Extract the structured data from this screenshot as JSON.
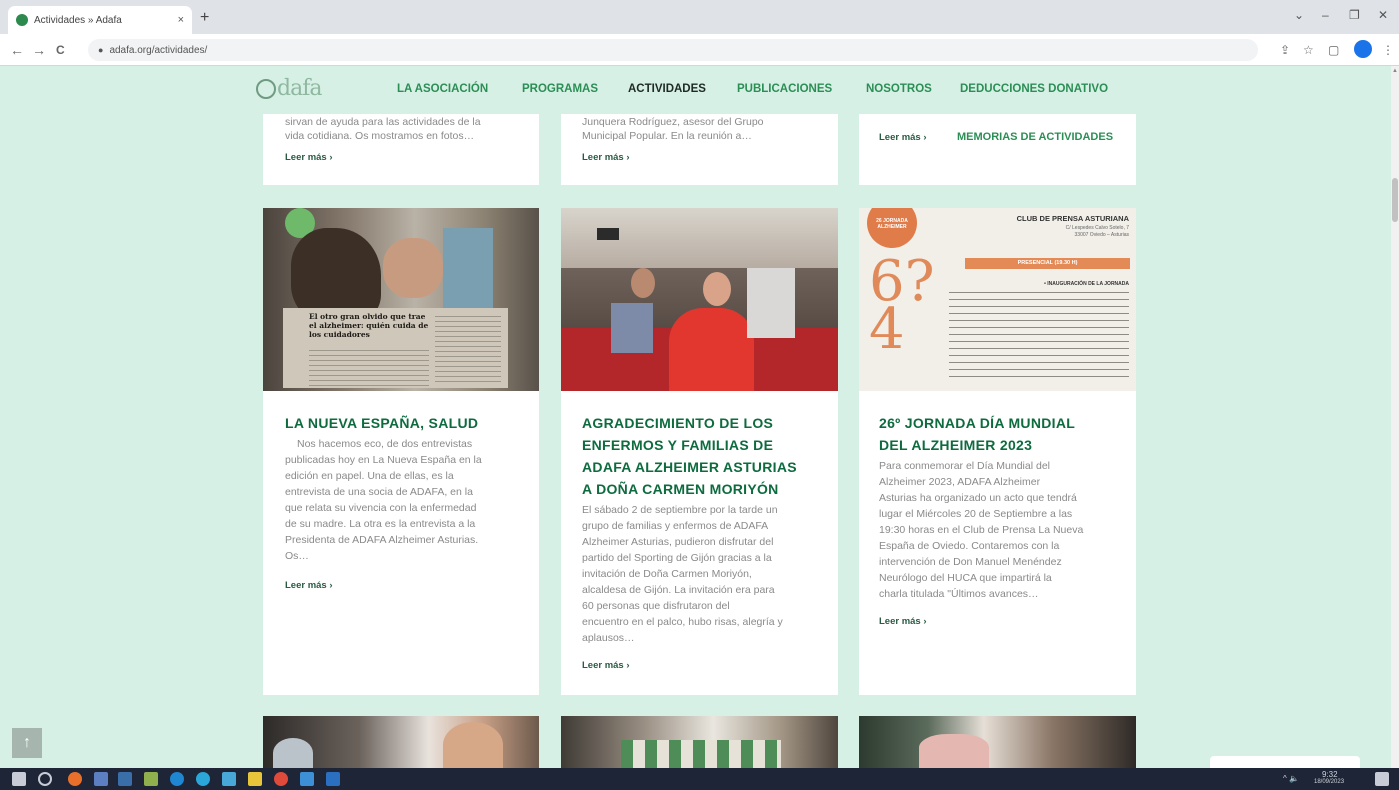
{
  "browser": {
    "tab_title": "Actividades » Adafa",
    "tab_close": "×",
    "new_tab": "+",
    "url": "adafa.org/actividades/",
    "nav": {
      "back": "←",
      "forward": "→",
      "reload": "C"
    },
    "window": {
      "minimize": "–",
      "maximize": "❐",
      "close": "✕",
      "collapse": "⌄"
    },
    "toolbar": {
      "share": "⇪",
      "star": "☆",
      "sidebar": "▢",
      "menu": "⋮"
    }
  },
  "site": {
    "logo_text": "dafa",
    "menu": [
      {
        "label": "LA ASOCIACIÓN",
        "active": false
      },
      {
        "label": "PROGRAMAS",
        "active": false
      },
      {
        "label": "ACTIVIDADES",
        "active": true
      },
      {
        "label": "PUBLICACIONES",
        "active": false
      },
      {
        "label": "NOSOTROS",
        "active": false
      },
      {
        "label": "DEDUCCIONES DONATIVO",
        "active": false
      }
    ],
    "submenu_label": "MEMORIAS DE ACTIVIDADES"
  },
  "top_cards": [
    {
      "excerpt_1": "sirvan de ayuda para las actividades de la",
      "excerpt_2": "vida cotidiana. Os mostramos en fotos…",
      "more": "Leer más ›"
    },
    {
      "excerpt_1": "Junquera Rodríguez, asesor del Grupo",
      "excerpt_2": "Municipal Popular. En la reunión a…",
      "more": "Leer más ›"
    },
    {
      "more": "Leer más ›"
    }
  ],
  "cards": [
    {
      "title_lines": [
        "LA NUEVA ESPAÑA, SALUD"
      ],
      "image_caption": "El otro gran olvido que trae el alzheimer: quién cuida de los cuidadores",
      "excerpt_lines": [
        "Nos hacemos eco, de dos entrevistas",
        "publicadas hoy en La Nueva España en la",
        "edición en papel. Una de ellas, es la",
        "entrevista de una socia de ADAFA, en la",
        "que relata su vivencia con la enfermedad",
        "de su madre. La otra es la entrevista a la",
        "Presidenta de ADAFA Alzheimer Asturias.",
        "Os…"
      ],
      "more": "Leer más ›"
    },
    {
      "title_lines": [
        "AGRADECIMIENTO DE LOS",
        "ENFERMOS Y FAMILIAS DE",
        "ADAFA ALZHEIMER ASTURIAS",
        "A DOÑA CARMEN MORIYÓN"
      ],
      "excerpt_lines": [
        "El sábado 2 de septiembre por la tarde un",
        "grupo de familias y  enfermos de ADAFA",
        "Alzheimer Asturias, pudieron disfrutar del",
        "partido del Sporting de Gijón gracias a la",
        "invitación de Doña Carmen Moriyón,",
        "alcaldesa de Gijón. La invitación era para",
        "60 personas que disfrutaron del",
        "encuentro en el palco, hubo risas, alegría y",
        "aplausos…"
      ],
      "more": "Leer más ›"
    },
    {
      "title_lines": [
        "26º JORNADA DÍA MUNDIAL",
        "DEL ALZHEIMER 2023"
      ],
      "poster": {
        "venue": "CLUB DE PRENSA ASTURIANA",
        "address_1": "C/ Lespedes Calvo Sotelo, 7",
        "address_2": "33007 Oviedo – Asturias",
        "band": "PRESENCIAL (19.30 H)",
        "section": "• INAUGURACIÓN DE LA JORNADA",
        "badge": "26 JORNADA ALZHEIMER"
      },
      "excerpt_lines": [
        "Para conmemorar el Día Mundial del",
        "Alzheimer 2023, ADAFA Alzheimer",
        "Asturias ha organizado un acto que tendrá",
        "lugar el Miércoles 20 de Septiembre a las",
        "19:30 horas en el Club de Prensa La Nueva",
        "España de Oviedo. Contaremos con la",
        "intervención de Don Manuel Menéndez",
        "Neurólogo del HUCA que impartirá la",
        "charla titulada \"Últimos avances…"
      ],
      "more": "Leer más ›"
    }
  ],
  "back_to_top": "↑",
  "taskbar": {
    "time": "9:32",
    "date": "18/09/2023",
    "tray": "^ 🔈"
  }
}
